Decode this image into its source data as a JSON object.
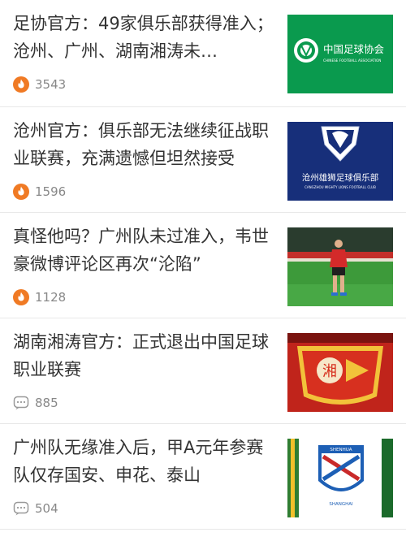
{
  "feed": {
    "items": [
      {
        "title": "足协官方：49家俱乐部获得准入；沧州、广州、湖南湘涛未…",
        "metric_type": "hot",
        "metric_icon": "flame-icon",
        "count": "3543",
        "thumb": {
          "type": "logo",
          "bg": "#0a9a4e",
          "text_cn": "中国足球协会",
          "text_en": "CHINESE FOOTBALL ASSOCIATION"
        }
      },
      {
        "title": "沧州官方：俱乐部无法继续征战职业联赛，充满遗憾但坦然接受",
        "metric_type": "hot",
        "metric_icon": "flame-icon",
        "count": "1596",
        "thumb": {
          "type": "logo",
          "bg": "#172f7a",
          "text_cn": "沧州雄狮足球俱乐部",
          "text_en": "CANGZHOU MIGHTY LIONS FOOTBALL CLUB"
        }
      },
      {
        "title": "真怪他吗？广州队未过准入，韦世豪微博评论区再次“沦陷”",
        "metric_type": "hot",
        "metric_icon": "flame-icon",
        "count": "1128",
        "thumb": {
          "type": "photo"
        }
      },
      {
        "title": "湖南湘涛官方：正式退出中国足球职业联赛",
        "metric_type": "comments",
        "metric_icon": "comment-icon",
        "count": "885",
        "thumb": {
          "type": "logo",
          "bg": "#c0241b"
        }
      },
      {
        "title": "广州队无缘准入后，甲A元年参赛队仅存国安、申花、泰山",
        "metric_type": "comments",
        "metric_icon": "comment-icon",
        "count": "504",
        "thumb": {
          "type": "logo",
          "bg": "#ffffff",
          "text_top": "SHENHUA",
          "text_bottom": "SHANGHAI"
        }
      }
    ]
  },
  "colors": {
    "flame": "#f07a24",
    "meta_text": "#888888",
    "title_text": "#333333",
    "divider": "#e8e8e8"
  }
}
